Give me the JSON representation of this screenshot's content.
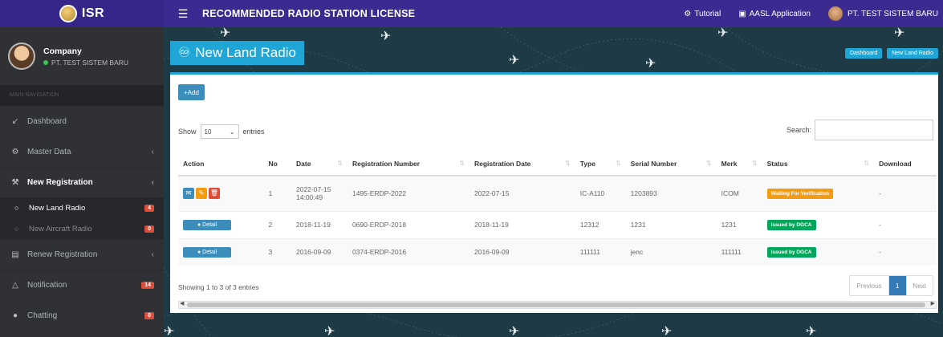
{
  "brand": {
    "name": "ISR"
  },
  "topbar": {
    "title": "RECOMMENDED RADIO STATION LICENSE",
    "tutorial": "Tutorial",
    "application": "AASL Application",
    "user": "PT. TEST SISTEM BARU"
  },
  "sidebar": {
    "user_name": "Company",
    "user_company": "PT. TEST SISTEM BARU",
    "nav_header": "MAIN NAVIGATION",
    "items": [
      {
        "label": "Dashboard",
        "icon": "line-chart-icon"
      },
      {
        "label": "Master Data",
        "icon": "gear-icon"
      },
      {
        "label": "New Registration",
        "icon": "wrench-icon"
      },
      {
        "label": "Renew Registration",
        "icon": "file-icon"
      },
      {
        "label": "Notification",
        "icon": "bell-icon",
        "badge": "14"
      },
      {
        "label": "Chatting",
        "icon": "chat-icon",
        "badge": "0"
      }
    ],
    "sub_items": [
      {
        "label": "New Land Radio",
        "badge": "4"
      },
      {
        "label": "New Aircraft Radio",
        "badge": "0"
      }
    ]
  },
  "content": {
    "title": "New Land Radio",
    "breadcrumb": [
      "Dashboard",
      "New Land Radio"
    ]
  },
  "toolbar": {
    "add_label": "+Add",
    "show_label": "Show",
    "length_value": "10",
    "entries_label": "entries",
    "search_label": "Search:"
  },
  "table": {
    "headers": [
      "Action",
      "No",
      "Date",
      "Registration Number",
      "Registration Date",
      "Type",
      "Serial Number",
      "Merk",
      "Status",
      "Download"
    ],
    "detail_label": "Detail",
    "rows": [
      {
        "no": "1",
        "date": "2022-07-15 14:00:49",
        "reg_number": "1495-ERDP-2022",
        "reg_date": "2022-07-15",
        "type": "IC-A110",
        "serial": "1203893",
        "merk": "ICOM",
        "status": "Waiting For Verification",
        "status_color": "#f39c12",
        "download": "-"
      },
      {
        "no": "2",
        "date": "2018-11-19",
        "reg_number": "0690-ERDP-2018",
        "reg_date": "2018-11-19",
        "type": "12312",
        "serial": "1231",
        "merk": "1231",
        "status": "Issued by DGCA",
        "status_color": "#00a65a",
        "download": "-"
      },
      {
        "no": "3",
        "date": "2016-09-09",
        "reg_number": "0374-ERDP-2016",
        "reg_date": "2016-09-09",
        "type": "111111",
        "serial": "jenc",
        "merk": "111111",
        "status": "Issued by DGCA",
        "status_color": "#00a65a",
        "download": "-"
      }
    ]
  },
  "footer": {
    "info": "Showing 1 to 3 of 3 entries",
    "previous": "Previous",
    "page": "1",
    "next": "Next"
  },
  "colors": {
    "topbar": "#3b2a8f",
    "sidebar": "#2f3135",
    "accent": "#1fa6d6",
    "primary": "#3c8dbc"
  }
}
